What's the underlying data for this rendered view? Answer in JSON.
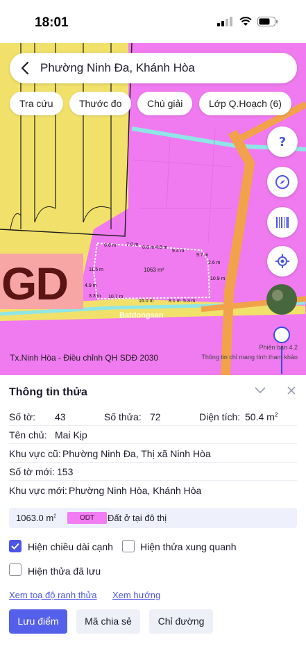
{
  "status_bar": {
    "time": "18:01"
  },
  "search": {
    "query": "Phường Ninh Đa, Khánh Hòa"
  },
  "chips": [
    "Tra cứu",
    "Thước đo",
    "Chú giải",
    "Lớp Q.Hoạch (6)"
  ],
  "map": {
    "zone_label": "GD",
    "parcel_area": "1063 m²",
    "edge_lengths": [
      "6.6 m",
      "7.0 m",
      "6.6 m",
      "4.8 m",
      "9.4 m",
      "9.7 m",
      "2.6 m",
      "10.9 m",
      "5.3 m",
      "8.1 m",
      "16.0 m",
      "10.7 m",
      "3.3 m",
      "4.9 m",
      "11.5 m"
    ],
    "caption_left": "Tx.Ninh Hòa - Điều chỉnh QH SDĐ 2030",
    "caption_right": "Thông tin chỉ mang tính tham khảo",
    "version": "Phiên bản 4.2",
    "watermark": "Batdongsan",
    "colors": {
      "residential_pink": "#f07af0",
      "agri_yellow": "#f1e16a",
      "road_orange": "#f2a24b",
      "water_cyan": "#8fe6e6"
    },
    "fab_icons": [
      "help-icon",
      "compass-icon",
      "barcode-icon",
      "locate-icon",
      "satellite-thumbnail"
    ]
  },
  "panel": {
    "title": "Thông tin thửa",
    "so_to_label": "Số tờ:",
    "so_to_value": "43",
    "so_thua_label": "Số thửa:",
    "so_thua_value": "72",
    "dien_tich_label": "Diện tích:",
    "dien_tich_value": "50.4 m",
    "dien_tich_unit_sup": "2",
    "ten_chu_label": "Tên chủ:",
    "ten_chu_value": "Mai Kịp",
    "khu_vuc_cu_label": "Khu vực cũ:",
    "khu_vuc_cu_value": "Phường Ninh Đa, Thị xã Ninh Hòa",
    "so_to_moi_label": "Số tờ mới:",
    "so_to_moi_value": "153",
    "khu_vuc_moi_label": "Khu vực mới:",
    "khu_vuc_moi_value": "Phường Ninh Hòa, Khánh Hòa",
    "area": "1063.0 m",
    "area_sup": "2",
    "land_code": "ODT",
    "land_type": "Đất ở tại đô thị",
    "checkboxes": [
      {
        "label": "Hiện chiều dài cạnh",
        "checked": true
      },
      {
        "label": "Hiện thửa xung quanh",
        "checked": false
      },
      {
        "label": "Hiện thửa đã lưu",
        "checked": false
      }
    ],
    "links": [
      "Xem toạ độ ranh thửa",
      "Xem hướng"
    ],
    "buttons": [
      "Lưu điểm",
      "Mã chia sẻ",
      "Chỉ đường"
    ],
    "accent_color": "#5560ea"
  }
}
